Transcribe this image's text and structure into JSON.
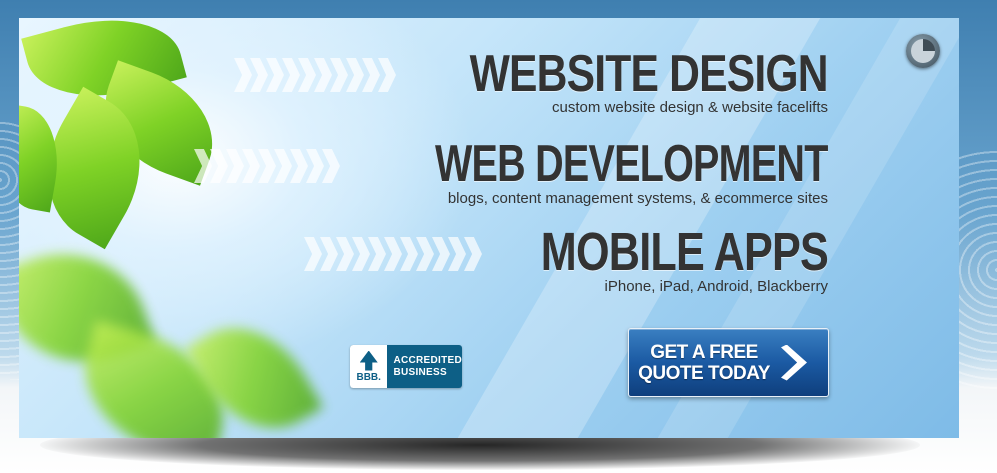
{
  "services": [
    {
      "title": "WEBSITE DESIGN",
      "subtitle": "custom website design & website facelifts"
    },
    {
      "title": "WEB DEVELOPMENT",
      "subtitle": "blogs, content management systems, & ecommerce sites"
    },
    {
      "title": "MOBILE APPS",
      "subtitle": "iPhone, iPad, Android, Blackberry"
    }
  ],
  "badge": {
    "seal_text": "BBB.",
    "line1": "ACCREDITED",
    "line2": "BUSINESS"
  },
  "cta": {
    "line1": "GET A FREE",
    "line2": "QUOTE TODAY"
  },
  "colors": {
    "background_top": "#3f7fb0",
    "headline_text": "#333333",
    "cta_blue": "#1b5aa3",
    "bbb_blue": "#0d5f86",
    "leaf_green": "#7fd226"
  },
  "icons": {
    "slideshow_control": "pie-timer-icon",
    "cta_arrow": "chevron-right-icon",
    "bbb_logo": "torch-icon"
  }
}
